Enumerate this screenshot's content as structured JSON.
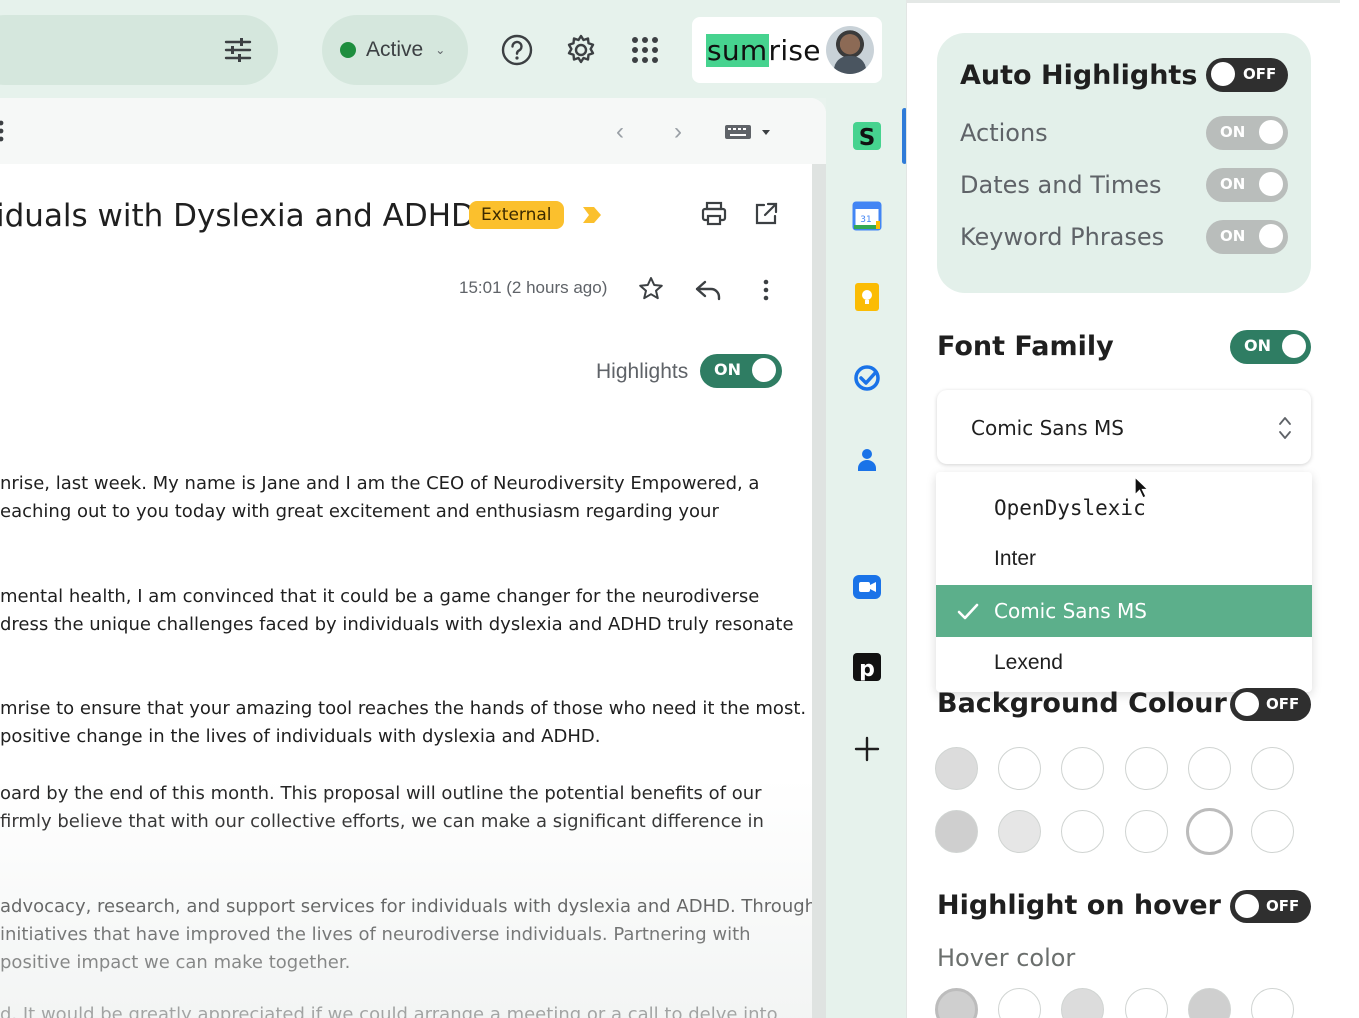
{
  "topbar": {
    "status_label": "Active",
    "brand_prefix": "sum",
    "brand_suffix": "rise"
  },
  "mail": {
    "subject": "iduals with Dyslexia and ADHD",
    "external_badge": "External",
    "timestamp": "15:01 (2 hours ago)",
    "highlights_label": "Highlights",
    "highlights_toggle": "ON",
    "body_lines": [
      "nrise, last week. My name is Jane and I am the CEO of Neurodiversity Empowered, a",
      "eaching out to you today with great excitement and enthusiasm regarding your",
      "mental health, I am convinced that it could be a game changer for the neurodiverse",
      "dress the unique challenges faced by individuals with dyslexia and ADHD truly resonate",
      "mrise to ensure that your amazing tool reaches the hands of those who need it the most.",
      "positive change in the lives of individuals with dyslexia and ADHD.",
      "oard by the end of this month. This proposal will outline the potential benefits of our",
      "firmly believe that with our collective efforts, we can make a significant difference in",
      "advocacy, research, and support services for individuals with dyslexia and ADHD. Through",
      " initiatives that have improved the lives of neurodiverse individuals. Partnering with",
      "positive impact we can make together.",
      "d. It would be greatly appreciated if we could arrange a meeting or a call to delve into"
    ]
  },
  "sidebar": {
    "icons": [
      "sumrise-s-icon",
      "calendar-icon",
      "keep-icon",
      "tasks-icon",
      "contacts-icon",
      "meet-icon",
      "p-app-icon",
      "add-icon"
    ],
    "calendar_day": "31"
  },
  "panel": {
    "auto_highlights": {
      "title": "Auto Highlights",
      "toggle": "OFF",
      "rows": [
        {
          "label": "Actions",
          "toggle": "ON"
        },
        {
          "label": "Dates and Times",
          "toggle": "ON"
        },
        {
          "label": "Keyword Phrases",
          "toggle": "ON"
        }
      ]
    },
    "font_family": {
      "title": "Font Family",
      "toggle": "ON",
      "selected_value": "Comic Sans MS",
      "options": [
        "OpenDyslexic",
        "Inter",
        "Comic Sans MS",
        "Lexend"
      ],
      "selected_index": 2
    },
    "background_colour": {
      "title": "Background Colour",
      "toggle": "OFF"
    },
    "highlight_on_hover": {
      "title": "Highlight on hover",
      "toggle": "OFF",
      "hover_color_label": "Hover color"
    }
  }
}
